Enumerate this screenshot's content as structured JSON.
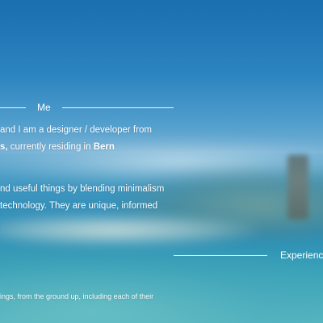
{
  "sections": {
    "me": {
      "label": "Me",
      "line1": "and I am a designer / developer from",
      "line2_prefix": "s,",
      "line2_middle": " currently residing in ",
      "line2_city": "Bern",
      "line3": "nd useful things by blending minimalism",
      "line4": "technology. They are unique, informed"
    },
    "experience": {
      "label": "Experience",
      "line1": "ings, from the ground up, including each of their"
    }
  },
  "colors": {
    "text": "#ffffff",
    "sky": "#1a6fae",
    "sea": "#2a8bb5"
  }
}
